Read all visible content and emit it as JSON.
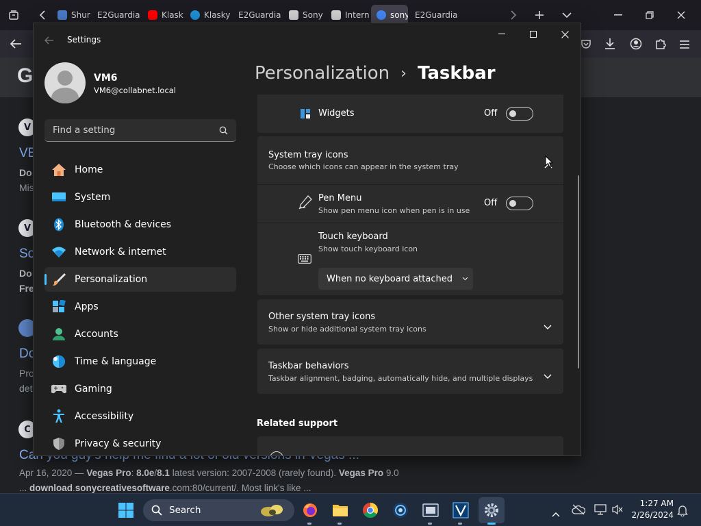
{
  "browser": {
    "tabs": [
      {
        "label": "Shurik",
        "favicon_color": "#4a7ac7"
      },
      {
        "label": "E2Guardia",
        "favicon_color": ""
      },
      {
        "label": "Klasky",
        "favicon_color": "#ff0000"
      },
      {
        "label": "Klasky",
        "favicon_color": "#1e8fd6"
      },
      {
        "label": "E2Guardia",
        "favicon_color": ""
      },
      {
        "label": "Sony",
        "favicon_color": "#cfcfcf"
      },
      {
        "label": "Intern",
        "favicon_color": "#cfcfcf"
      },
      {
        "label": "sony",
        "favicon_color": "#4285f4"
      },
      {
        "label": "E2Guardia",
        "favicon_color": ""
      }
    ],
    "active_tab_index": 7
  },
  "background_page": {
    "logo_letter": "G",
    "results": [
      {
        "title": "VE",
        "lines": [
          "Do",
          "Mis"
        ]
      },
      {
        "title": "So",
        "lines": [
          "Do",
          "Fre"
        ]
      },
      {
        "title": "Do",
        "lines": [
          "Pro",
          "det"
        ]
      }
    ],
    "bottom_title": "Can you guy's help me find a lot of old versions in Vegas ...",
    "bottom_line1_prefix": "Apr 16, 2020 — ",
    "bottom_line1_b1": "Vegas Pro",
    "bottom_line1_mid": ": ",
    "bottom_line1_b2": "8.0e",
    "bottom_line1_sep": "/",
    "bottom_line1_b3": "8.1",
    "bottom_line1_mid2": " latest version: 2007-2008 (rarely found). ",
    "bottom_line1_b4": "Vegas Pro",
    "bottom_line1_end": " 9.0",
    "bottom_line2_prefix": "... ",
    "bottom_line2_b1": "download",
    "bottom_line2_mid1": ".",
    "bottom_line2_b2": "sonycreativesoftware",
    "bottom_line2_end": ".com:80/current/. Most link's like ..."
  },
  "settings": {
    "window_title": "Settings",
    "user": {
      "name": "VM6",
      "email": "VM6@collabnet.local"
    },
    "search_placeholder": "Find a setting",
    "nav": [
      {
        "label": "Home",
        "icon": "home-icon",
        "selected": false
      },
      {
        "label": "System",
        "icon": "system-icon",
        "selected": false
      },
      {
        "label": "Bluetooth & devices",
        "icon": "bluetooth-icon",
        "selected": false
      },
      {
        "label": "Network & internet",
        "icon": "network-icon",
        "selected": false
      },
      {
        "label": "Personalization",
        "icon": "personalization-icon",
        "selected": true
      },
      {
        "label": "Apps",
        "icon": "apps-icon",
        "selected": false
      },
      {
        "label": "Accounts",
        "icon": "accounts-icon",
        "selected": false
      },
      {
        "label": "Time & language",
        "icon": "time-language-icon",
        "selected": false
      },
      {
        "label": "Gaming",
        "icon": "gaming-icon",
        "selected": false
      },
      {
        "label": "Accessibility",
        "icon": "accessibility-icon",
        "selected": false
      },
      {
        "label": "Privacy & security",
        "icon": "privacy-icon",
        "selected": false
      }
    ],
    "breadcrumb": {
      "parent": "Personalization",
      "separator": "›",
      "current": "Taskbar"
    },
    "widgets": {
      "title": "Widgets",
      "state": "Off"
    },
    "system_tray": {
      "title": "System tray icons",
      "subtitle": "Choose which icons can appear in the system tray"
    },
    "pen_menu": {
      "title": "Pen Menu",
      "subtitle": "Show pen menu icon when pen is in use",
      "state": "Off"
    },
    "touch_keyboard": {
      "title": "Touch keyboard",
      "subtitle": "Show touch keyboard icon",
      "dropdown_value": "When no keyboard attached"
    },
    "other_tray": {
      "title": "Other system tray icons",
      "subtitle": "Show or hide additional system tray icons"
    },
    "behaviors": {
      "title": "Taskbar behaviors",
      "subtitle": "Taskbar alignment, badging, automatically hide, and multiple displays"
    },
    "related_support": "Related support"
  },
  "taskbar": {
    "search_label": "Search",
    "time": "1:27 AM",
    "date": "2/26/2024"
  }
}
